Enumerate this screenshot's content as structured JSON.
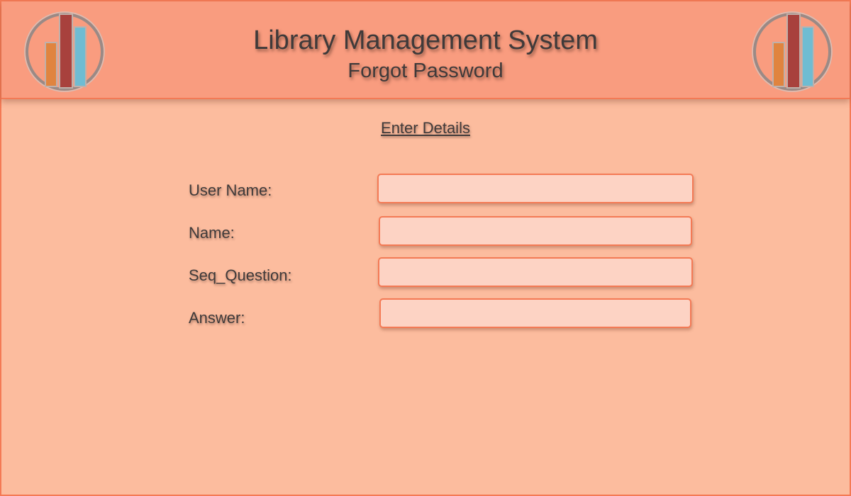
{
  "header": {
    "title": "Library Management System",
    "subtitle": "Forgot Password",
    "logo_icon": "books-logo-icon",
    "colors": {
      "header_background": "#f99c7f",
      "page_background": "#fcbc9e",
      "border": "#f47a55",
      "input_background": "#fdd3c4",
      "text": "#3f3a3a",
      "book_orange": "#e0843f",
      "book_red": "#a8413d",
      "book_blue": "#6fbcd2"
    }
  },
  "form": {
    "heading": "Enter Details",
    "fields": [
      {
        "label": "User Name:",
        "value": "",
        "placeholder": ""
      },
      {
        "label": "Name:",
        "value": "",
        "placeholder": ""
      },
      {
        "label": "Seq_Question:",
        "value": "",
        "placeholder": ""
      },
      {
        "label": "Answer:",
        "value": "",
        "placeholder": ""
      }
    ]
  }
}
